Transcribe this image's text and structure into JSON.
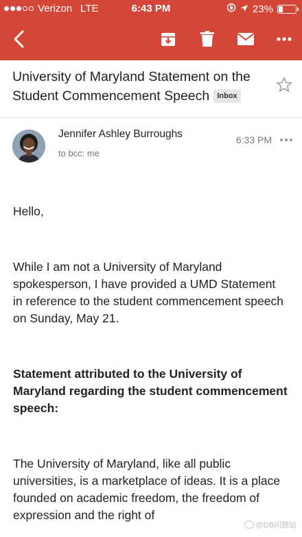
{
  "status_bar": {
    "carrier": "Verizon",
    "network": "LTE",
    "time": "6:43 PM",
    "battery_percent": "23%",
    "battery_level": 0.23,
    "signal_bars_filled": 3,
    "signal_bars_total": 5
  },
  "toolbar": {
    "icons": [
      "back-arrow-icon",
      "archive-icon",
      "trash-icon",
      "mark-unread-icon",
      "more-options-icon"
    ]
  },
  "email": {
    "subject": "University of Maryland Statement on the Student Commencement Speech",
    "label": "Inbox",
    "sender_name": "Jennifer Ashley Burroughs",
    "recipients": "to bcc: me",
    "time": "6:33 PM",
    "paragraphs": [
      "Hello,",
      "While I am not a University of Maryland spokesperson, I have provided a UMD Statement in reference to the student commencement speech on Sunday, May 21.",
      "Statement attributed to the University of Maryland regarding the student commencement speech:",
      "The University of Maryland, like all public universities, is a marketplace of ideas. It is a place founded on academic freedom, the freedom of expression and the right of"
    ]
  },
  "watermark": "@DB问题站",
  "colors": {
    "header": "#d44638",
    "divider": "#e3e3e3",
    "label_chip_bg": "#e6e6e6"
  }
}
